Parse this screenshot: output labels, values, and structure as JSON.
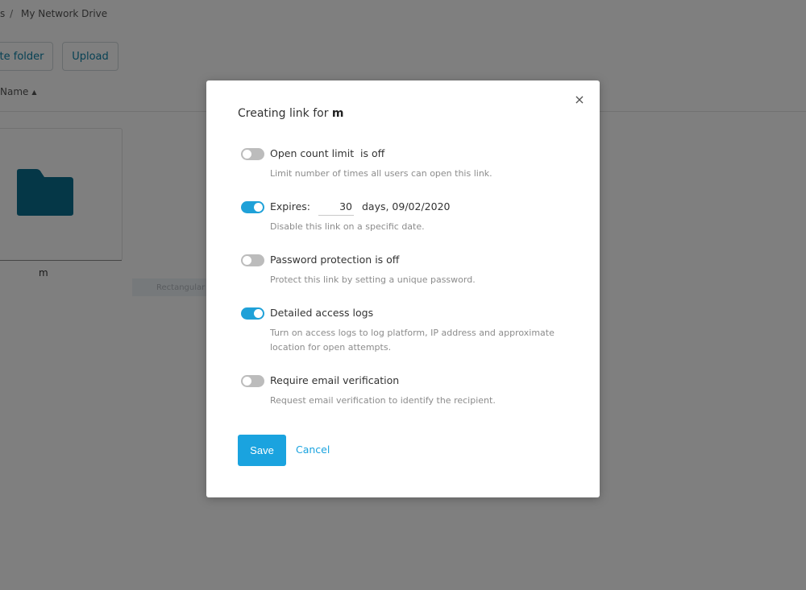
{
  "breadcrumb": {
    "parent": "s",
    "separator": "/",
    "current": "My Network Drive"
  },
  "toolbar": {
    "create_folder_label": "te folder",
    "upload_label": "Upload"
  },
  "list_header": {
    "sort_label": "Name",
    "sort_direction": "ascending"
  },
  "folders": [
    {
      "name": "m",
      "icon": "folder-icon",
      "color": "#0a6f8f"
    }
  ],
  "snip_ghost": {
    "label": "Rectangular Snip"
  },
  "modal": {
    "title_prefix": "Creating link for",
    "title_target": "m",
    "close_symbol": "×",
    "options": [
      {
        "label": "Open count limit  is off",
        "enabled": false,
        "description": "Limit number of times all users can open this link."
      },
      {
        "label_prefix": "Expires:",
        "days_value": "30",
        "label_suffix": "days, 09/02/2020",
        "enabled": true,
        "description": "Disable this link on a specific date."
      },
      {
        "label": "Password protection is off",
        "enabled": false,
        "description": "Protect this link by setting a unique password."
      },
      {
        "label": "Detailed access logs",
        "enabled": true,
        "description": "Turn on access logs to log platform, IP address and approximate location for open attempts."
      },
      {
        "label": "Require email verification",
        "enabled": false,
        "description": "Request email verification to identify the recipient."
      }
    ],
    "save_label": "Save",
    "cancel_label": "Cancel"
  },
  "colors": {
    "accent": "#1aa3df",
    "toggle_off": "#bcbcbc",
    "overlay": "rgba(0,0,0,0.5)"
  }
}
